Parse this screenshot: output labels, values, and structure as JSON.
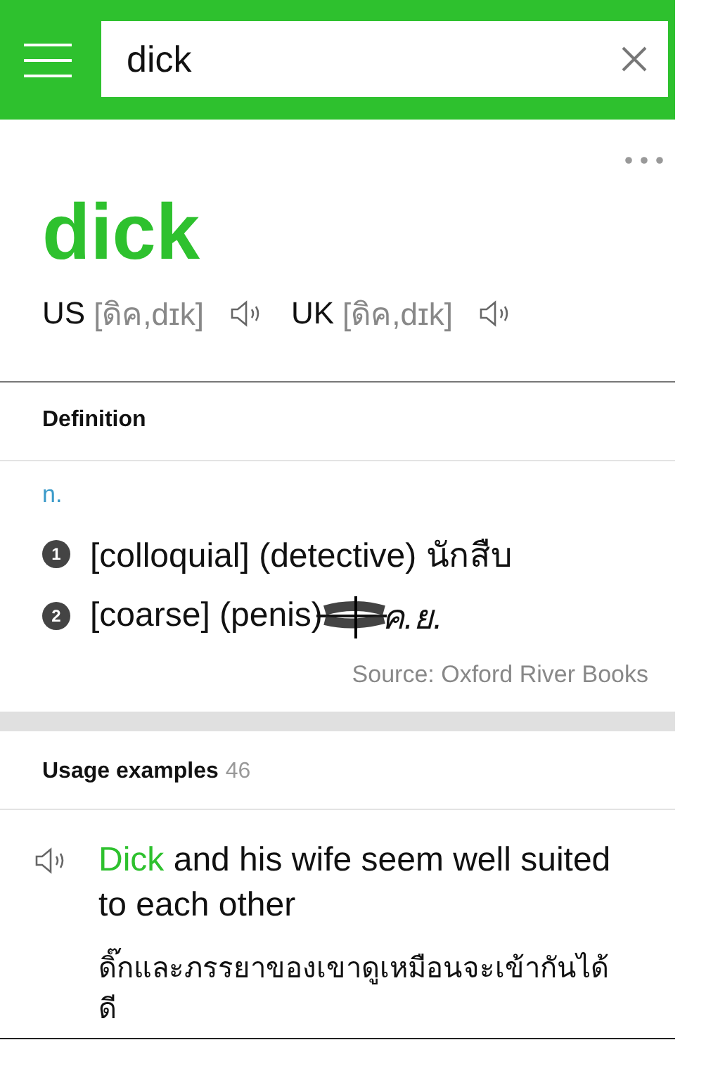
{
  "search": {
    "value": "dick"
  },
  "entry": {
    "headword": "dick",
    "pronunciations": [
      {
        "region": "US",
        "ipa": "[ดิค,dɪk]"
      },
      {
        "region": "UK",
        "ipa": "[ดิค,dɪk]"
      }
    ]
  },
  "definition": {
    "title": "Definition",
    "part_of_speech": "n.",
    "senses": [
      {
        "number": "1",
        "text": "[colloquial] (detective) นักสืบ",
        "scribbled": false
      },
      {
        "number": "2",
        "text": "[coarse] (penis)",
        "scribbled": true,
        "after": "ค.ย."
      }
    ],
    "source": "Source: Oxford River Books"
  },
  "usage": {
    "title": "Usage examples",
    "count": "46",
    "examples": [
      {
        "highlight": "Dick",
        "text": " and his wife seem well suited to each other",
        "translation": "ดิ๊กและภรรยาของเขาดูเหมือนจะเข้ากันได้ดี"
      }
    ]
  }
}
